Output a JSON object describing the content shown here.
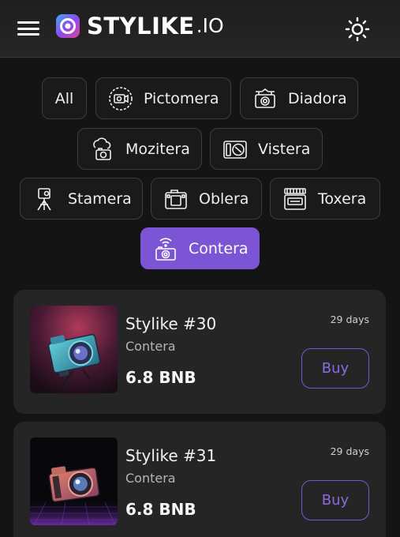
{
  "header": {
    "brand": "STYLIKE",
    "brand_suffix": ".IO"
  },
  "filters": [
    {
      "label": "All",
      "icon": null,
      "active": false
    },
    {
      "label": "Pictomera",
      "icon": "pictomera-icon",
      "active": false
    },
    {
      "label": "Diadora",
      "icon": "diadora-icon",
      "active": false
    },
    {
      "label": "Mozitera",
      "icon": "mozitera-icon",
      "active": false
    },
    {
      "label": "Vistera",
      "icon": "vistera-icon",
      "active": false
    },
    {
      "label": "Stamera",
      "icon": "stamera-icon",
      "active": false
    },
    {
      "label": "Oblera",
      "icon": "oblera-icon",
      "active": false
    },
    {
      "label": "Toxera",
      "icon": "toxera-icon",
      "active": false
    },
    {
      "label": "Contera",
      "icon": "contera-icon",
      "active": true
    }
  ],
  "listings": [
    {
      "title": "Stylike #30",
      "category": "Contera",
      "price": "6.8 BNB",
      "time_left": "29 days",
      "buy_label": "Buy"
    },
    {
      "title": "Stylike #31",
      "category": "Contera",
      "price": "6.8 BNB",
      "time_left": "29 days",
      "buy_label": "Buy"
    }
  ],
  "colors": {
    "accent": "#7b55d4",
    "background": "#141414",
    "card": "#252525"
  }
}
